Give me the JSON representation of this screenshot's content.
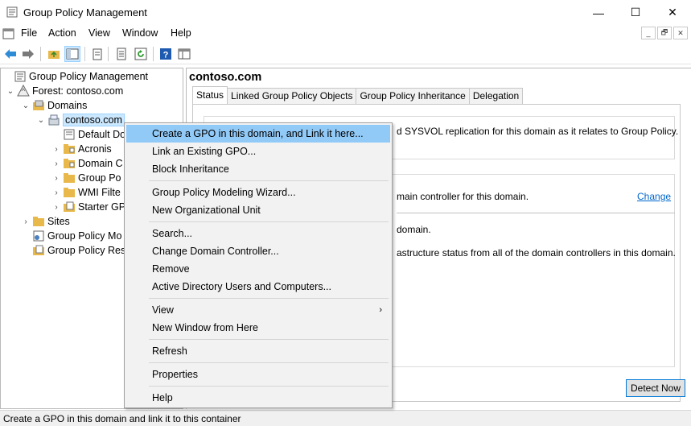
{
  "window": {
    "title": "Group Policy Management",
    "minimize": "—",
    "maximize": "☐",
    "close": "✕"
  },
  "menubar": {
    "items": [
      "File",
      "Action",
      "View",
      "Window",
      "Help"
    ],
    "mdi": [
      "_",
      "🗗",
      "✕"
    ]
  },
  "tree": {
    "root": "Group Policy Management",
    "forest": "Forest: contoso.com",
    "domains": "Domains",
    "domain": "contoso.com",
    "children": [
      "Default Do",
      "Acronis",
      "Domain C",
      "Group Po",
      "WMI Filte",
      "Starter GP"
    ],
    "sites": "Sites",
    "modeling": "Group Policy Mo",
    "results": "Group Policy Res"
  },
  "right": {
    "title": "contoso.com",
    "tabs": [
      "Status",
      "Linked Group Policy Objects",
      "Group Policy Inheritance",
      "Delegation"
    ],
    "line1": "d SYSVOL replication for this domain as it relates to Group Policy.",
    "line2": "main controller for this domain.",
    "change": "Change",
    "line3": "domain.",
    "line4": "astructure status from all of the domain controllers in this domain.",
    "detect": "Detect Now"
  },
  "context_menu": {
    "items": [
      "Create a GPO in this domain, and Link it here...",
      "Link an Existing GPO...",
      "Block Inheritance",
      "Group Policy Modeling Wizard...",
      "New Organizational Unit",
      "Search...",
      "Change Domain Controller...",
      "Remove",
      "Active Directory Users and Computers...",
      "View",
      "New Window from Here",
      "Refresh",
      "Properties",
      "Help"
    ],
    "submenu_arrow": "›"
  },
  "status": {
    "text": "Create a GPO in this domain and link it to this container"
  },
  "colors": {
    "highlight": "#91c9f7",
    "selection": "#cce8ff",
    "link": "#0066cc",
    "folder": "#e8b84a"
  }
}
